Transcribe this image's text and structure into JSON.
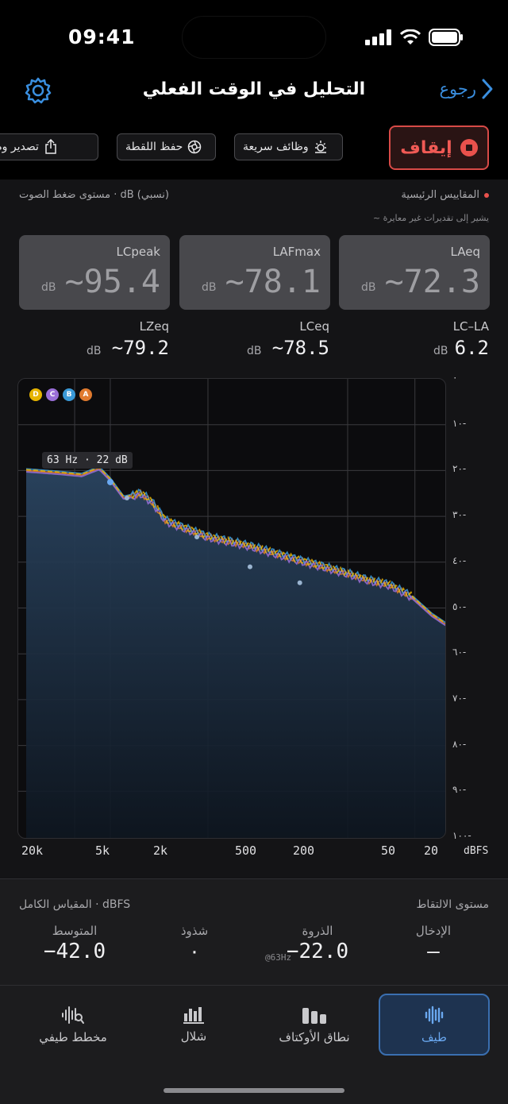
{
  "status": {
    "time": "09:41"
  },
  "nav": {
    "title": "التحليل في الوقت الفعلي",
    "back_label": "رجوع"
  },
  "toolbar": {
    "stop_label": "إيقاف",
    "quick_functions_label": "وظائف سريعة",
    "save_snapshot_label": "حفظ اللقطة",
    "export_label": "تصدير وم"
  },
  "metrics": {
    "header_right": "المقاييس الرئيسية",
    "header_left": "مستوى ضغط الصوت · dB (نسبي)",
    "hint": "~ يشير إلى تقديرات غير معايرة",
    "cards": [
      {
        "label": "LAeq",
        "value": "~72.3",
        "unit": "dB"
      },
      {
        "label": "LAFmax",
        "value": "~78.1",
        "unit": "dB"
      },
      {
        "label": "LCpeak",
        "value": "~95.4",
        "unit": "dB"
      }
    ],
    "secondary": [
      {
        "label": "LC–LA",
        "value": "6.2",
        "unit": "dB"
      },
      {
        "label": "LCeq",
        "value": "~78.5",
        "unit": "dB"
      },
      {
        "label": "LZeq",
        "value": "~79.2",
        "unit": "dB"
      }
    ]
  },
  "chart_data": {
    "type": "line",
    "title": "",
    "xlabel": "",
    "ylabel": "dBFS",
    "x_scale": "log",
    "x_axis_direction": "reversed",
    "x_ticks": [
      "20k",
      "5k",
      "2k",
      "500",
      "200",
      "50",
      "20"
    ],
    "x_tick_values": [
      20000,
      5000,
      2000,
      500,
      200,
      50,
      20
    ],
    "y_ticks": [
      "٠",
      "١٠-",
      "٢٠-",
      "٣٠-",
      "٤٠-",
      "٥٠-",
      "٦٠-",
      "٧٠-",
      "٨٠-",
      "٩٠-",
      "١٠٠-"
    ],
    "ylim": [
      -100,
      0
    ],
    "grid": true,
    "legend": [
      {
        "key": "D",
        "color": "#e6b400"
      },
      {
        "key": "C",
        "color": "#9a6fd8"
      },
      {
        "key": "B",
        "color": "#3a9ad8"
      },
      {
        "key": "A",
        "color": "#e07a2e"
      }
    ],
    "tooltip": "63 Hz · 22 dB",
    "x": [
      20000,
      12000,
      8000,
      6000,
      5000,
      4000,
      3000,
      2500,
      2000,
      1500,
      1000,
      700,
      500,
      300,
      200,
      150,
      100,
      70,
      50,
      35,
      25,
      20
    ],
    "series": [
      {
        "values": [
          -20.0,
          -20.5,
          -21.0,
          -19.5,
          -22.0,
          -26.0,
          -25.0,
          -27.0,
          -31.0,
          -32.5,
          -34.5,
          -35.5,
          -36.5,
          -38.5,
          -40.0,
          -41.0,
          -42.5,
          -44.0,
          -45.0,
          -47.5,
          -51.5,
          -53.5
        ]
      }
    ],
    "peaks": [
      {
        "x": 5000,
        "y": -22.0
      },
      {
        "x": 3800,
        "y": -26.0
      },
      {
        "x": 1200,
        "y": -34.5
      },
      {
        "x": 500,
        "y": -41.0
      },
      {
        "x": 220,
        "y": -44.5
      }
    ]
  },
  "info": {
    "right_title": "مستوى الالتقاط",
    "left_title": "المقياس الكامل · dBFS",
    "stats": [
      {
        "label": "الإدخال",
        "value": "–"
      },
      {
        "label": "الذروة",
        "value": "−22.0",
        "sub": "@63Hz"
      },
      {
        "label": "شذوذ",
        "value": "٠"
      },
      {
        "label": "المتوسط",
        "value": "−42.0"
      }
    ]
  },
  "tabs": [
    {
      "label": "طيف",
      "icon": "waveform-icon"
    },
    {
      "label": "نطاق الأوكتاف",
      "icon": "octave-bars-icon"
    },
    {
      "label": "شلال",
      "icon": "waterfall-icon"
    },
    {
      "label": "مخطط طيفي",
      "icon": "spectrogram-icon"
    }
  ],
  "colors": {
    "accent": "#3a8fe0",
    "stop": "#e8514c",
    "tab_active_bg": "#1e3350"
  }
}
